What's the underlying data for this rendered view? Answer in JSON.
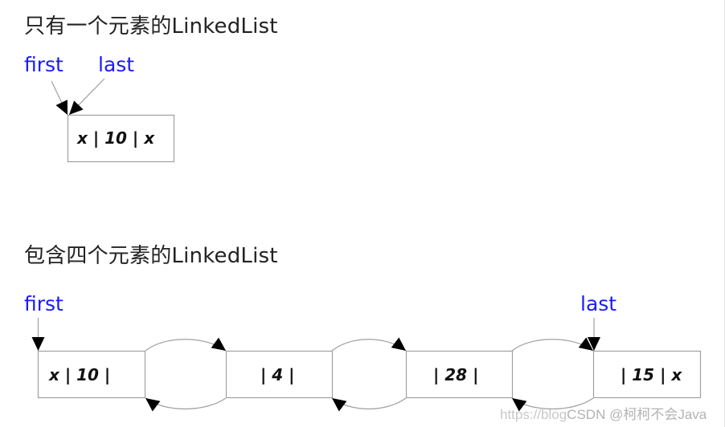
{
  "single_list": {
    "title": "只有一个元素的LinkedList",
    "first_label": "first",
    "last_label": "last",
    "nodes": [
      {
        "text": "x | 10 | x"
      }
    ]
  },
  "four_list": {
    "title": "包含四个元素的LinkedList",
    "first_label": "first",
    "last_label": "last",
    "nodes": [
      {
        "text": "x | 10 |"
      },
      {
        "text": "| 4 |"
      },
      {
        "text": "| 28 |"
      },
      {
        "text": "| 15 | x"
      }
    ]
  },
  "watermark": {
    "url_part": "https://blog",
    "author": "CSDN @柯柯不会Java"
  },
  "colors": {
    "pointer_label": "#1a1aff",
    "box_stroke": "#a0a0a0",
    "arrow": "#000000",
    "text": "#222222"
  }
}
